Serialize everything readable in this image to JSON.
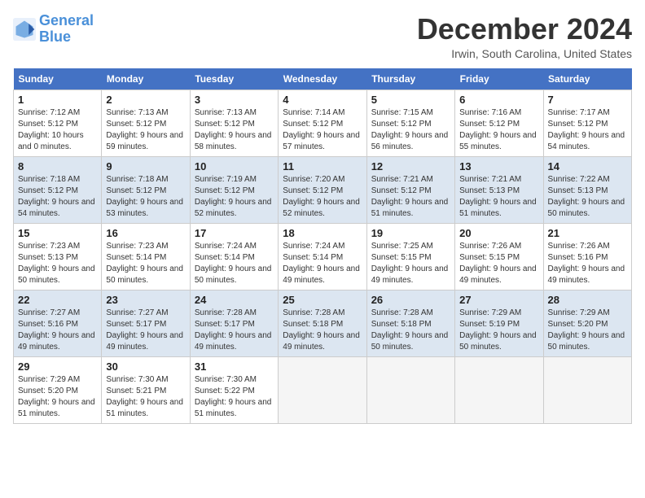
{
  "header": {
    "logo_line1": "General",
    "logo_line2": "Blue",
    "month": "December 2024",
    "location": "Irwin, South Carolina, United States"
  },
  "days_of_week": [
    "Sunday",
    "Monday",
    "Tuesday",
    "Wednesday",
    "Thursday",
    "Friday",
    "Saturday"
  ],
  "weeks": [
    [
      {
        "day": "1",
        "sunrise": "7:12 AM",
        "sunset": "5:12 PM",
        "daylight": "10 hours and 0 minutes."
      },
      {
        "day": "2",
        "sunrise": "7:13 AM",
        "sunset": "5:12 PM",
        "daylight": "9 hours and 59 minutes."
      },
      {
        "day": "3",
        "sunrise": "7:13 AM",
        "sunset": "5:12 PM",
        "daylight": "9 hours and 58 minutes."
      },
      {
        "day": "4",
        "sunrise": "7:14 AM",
        "sunset": "5:12 PM",
        "daylight": "9 hours and 57 minutes."
      },
      {
        "day": "5",
        "sunrise": "7:15 AM",
        "sunset": "5:12 PM",
        "daylight": "9 hours and 56 minutes."
      },
      {
        "day": "6",
        "sunrise": "7:16 AM",
        "sunset": "5:12 PM",
        "daylight": "9 hours and 55 minutes."
      },
      {
        "day": "7",
        "sunrise": "7:17 AM",
        "sunset": "5:12 PM",
        "daylight": "9 hours and 54 minutes."
      }
    ],
    [
      {
        "day": "8",
        "sunrise": "7:18 AM",
        "sunset": "5:12 PM",
        "daylight": "9 hours and 54 minutes."
      },
      {
        "day": "9",
        "sunrise": "7:18 AM",
        "sunset": "5:12 PM",
        "daylight": "9 hours and 53 minutes."
      },
      {
        "day": "10",
        "sunrise": "7:19 AM",
        "sunset": "5:12 PM",
        "daylight": "9 hours and 52 minutes."
      },
      {
        "day": "11",
        "sunrise": "7:20 AM",
        "sunset": "5:12 PM",
        "daylight": "9 hours and 52 minutes."
      },
      {
        "day": "12",
        "sunrise": "7:21 AM",
        "sunset": "5:12 PM",
        "daylight": "9 hours and 51 minutes."
      },
      {
        "day": "13",
        "sunrise": "7:21 AM",
        "sunset": "5:13 PM",
        "daylight": "9 hours and 51 minutes."
      },
      {
        "day": "14",
        "sunrise": "7:22 AM",
        "sunset": "5:13 PM",
        "daylight": "9 hours and 50 minutes."
      }
    ],
    [
      {
        "day": "15",
        "sunrise": "7:23 AM",
        "sunset": "5:13 PM",
        "daylight": "9 hours and 50 minutes."
      },
      {
        "day": "16",
        "sunrise": "7:23 AM",
        "sunset": "5:14 PM",
        "daylight": "9 hours and 50 minutes."
      },
      {
        "day": "17",
        "sunrise": "7:24 AM",
        "sunset": "5:14 PM",
        "daylight": "9 hours and 50 minutes."
      },
      {
        "day": "18",
        "sunrise": "7:24 AM",
        "sunset": "5:14 PM",
        "daylight": "9 hours and 49 minutes."
      },
      {
        "day": "19",
        "sunrise": "7:25 AM",
        "sunset": "5:15 PM",
        "daylight": "9 hours and 49 minutes."
      },
      {
        "day": "20",
        "sunrise": "7:26 AM",
        "sunset": "5:15 PM",
        "daylight": "9 hours and 49 minutes."
      },
      {
        "day": "21",
        "sunrise": "7:26 AM",
        "sunset": "5:16 PM",
        "daylight": "9 hours and 49 minutes."
      }
    ],
    [
      {
        "day": "22",
        "sunrise": "7:27 AM",
        "sunset": "5:16 PM",
        "daylight": "9 hours and 49 minutes."
      },
      {
        "day": "23",
        "sunrise": "7:27 AM",
        "sunset": "5:17 PM",
        "daylight": "9 hours and 49 minutes."
      },
      {
        "day": "24",
        "sunrise": "7:28 AM",
        "sunset": "5:17 PM",
        "daylight": "9 hours and 49 minutes."
      },
      {
        "day": "25",
        "sunrise": "7:28 AM",
        "sunset": "5:18 PM",
        "daylight": "9 hours and 49 minutes."
      },
      {
        "day": "26",
        "sunrise": "7:28 AM",
        "sunset": "5:18 PM",
        "daylight": "9 hours and 50 minutes."
      },
      {
        "day": "27",
        "sunrise": "7:29 AM",
        "sunset": "5:19 PM",
        "daylight": "9 hours and 50 minutes."
      },
      {
        "day": "28",
        "sunrise": "7:29 AM",
        "sunset": "5:20 PM",
        "daylight": "9 hours and 50 minutes."
      }
    ],
    [
      {
        "day": "29",
        "sunrise": "7:29 AM",
        "sunset": "5:20 PM",
        "daylight": "9 hours and 51 minutes."
      },
      {
        "day": "30",
        "sunrise": "7:30 AM",
        "sunset": "5:21 PM",
        "daylight": "9 hours and 51 minutes."
      },
      {
        "day": "31",
        "sunrise": "7:30 AM",
        "sunset": "5:22 PM",
        "daylight": "9 hours and 51 minutes."
      },
      null,
      null,
      null,
      null
    ]
  ]
}
